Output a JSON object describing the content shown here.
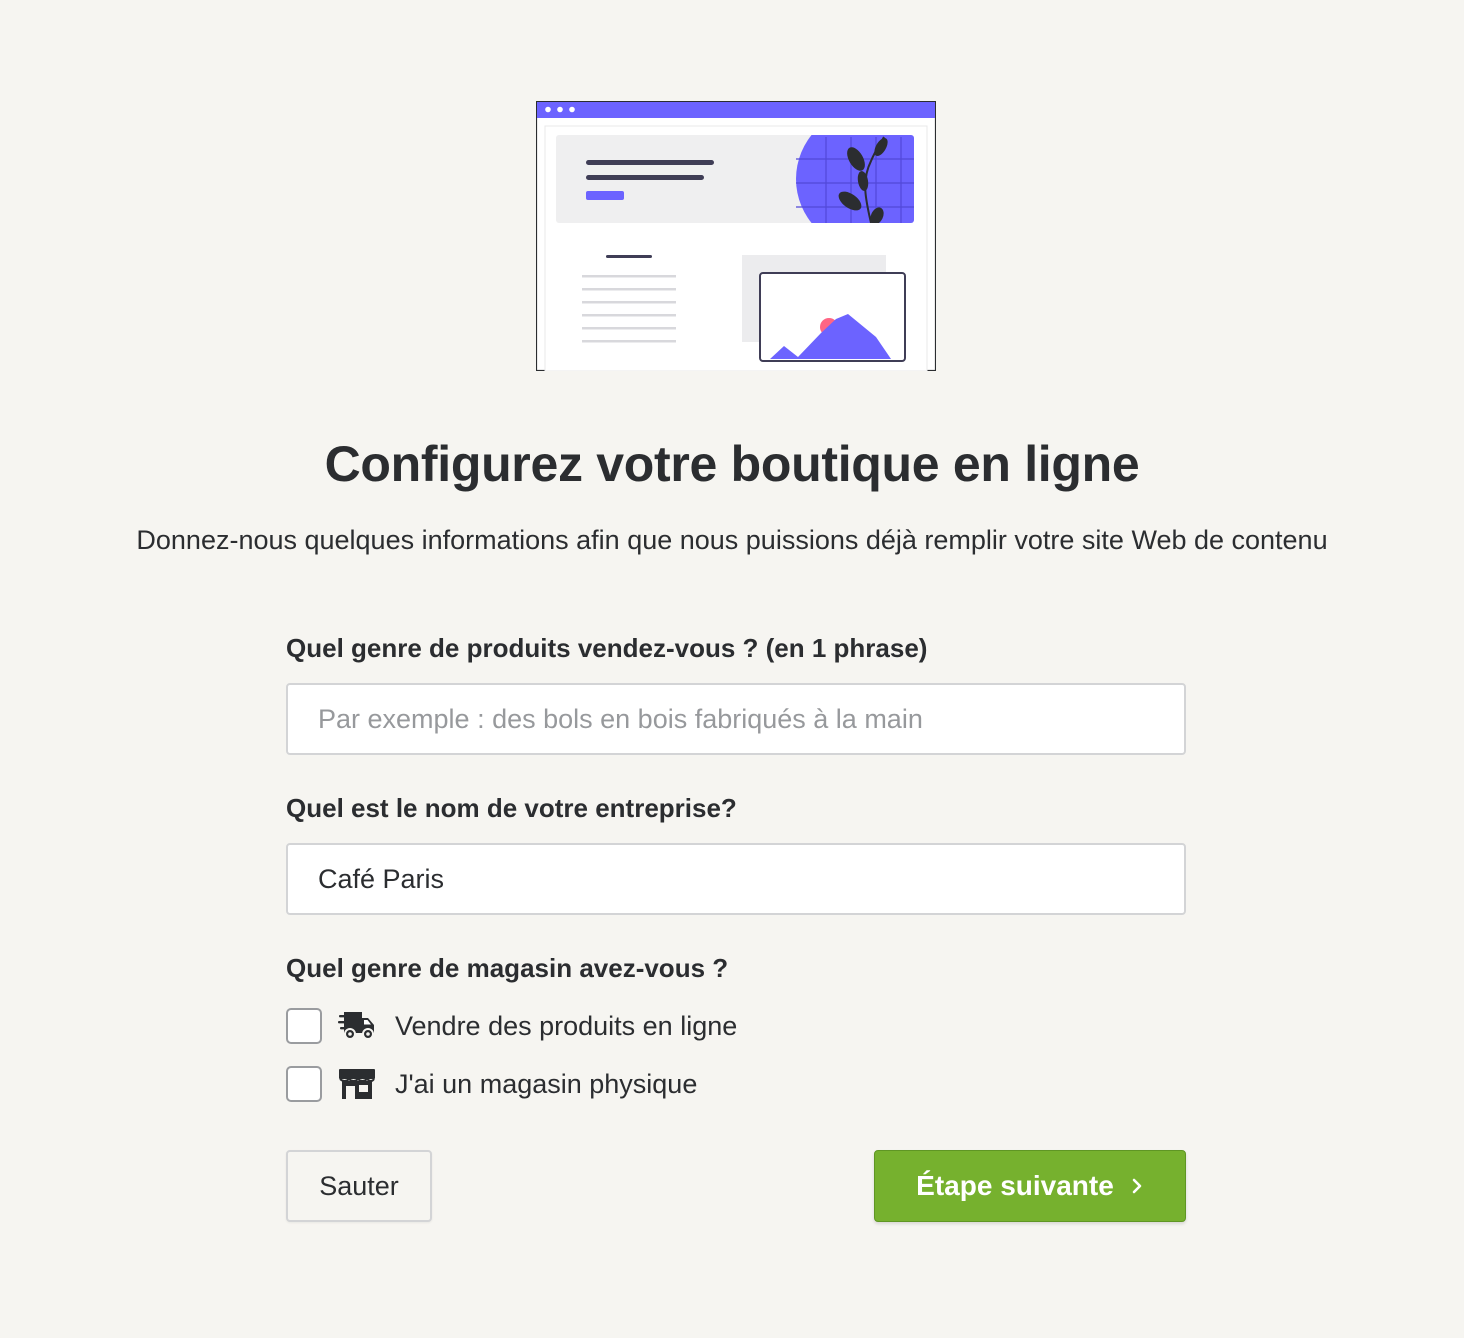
{
  "colors": {
    "background": "#f6f5f1",
    "accent_purple": "#6c63ff",
    "primary_green": "#76b12e",
    "text_dark": "#2b2d30"
  },
  "illustration": {
    "icon": "website-builder-illustration"
  },
  "header": {
    "title": "Configurez votre boutique en ligne",
    "subtitle": "Donnez-nous quelques informations afin que nous puissions déjà remplir votre site Web de contenu"
  },
  "form": {
    "products": {
      "label": "Quel genre de produits vendez-vous ? (en 1 phrase)",
      "value": "",
      "placeholder": "Par exemple : des bols en bois fabriqués à la main"
    },
    "company": {
      "label": "Quel est le nom de votre entreprise?",
      "value": "Café Paris",
      "placeholder": ""
    },
    "store_type": {
      "label": "Quel genre de magasin avez-vous ?",
      "options": [
        {
          "label": "Vendre des produits en ligne",
          "icon": "delivery-truck-icon",
          "checked": false
        },
        {
          "label": "J'ai un magasin physique",
          "icon": "storefront-icon",
          "checked": false
        }
      ]
    }
  },
  "actions": {
    "skip_label": "Sauter",
    "next_label": "Étape suivante",
    "next_icon": "chevron-right-icon"
  }
}
